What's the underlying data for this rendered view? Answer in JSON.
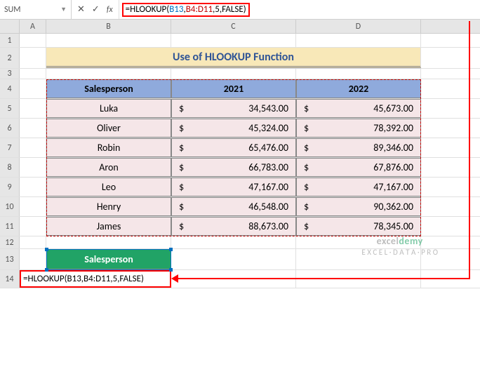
{
  "name_box": "SUM",
  "formula_bar": {
    "eq": "=",
    "fn": "HLOOKUP(",
    "ref1": "B13",
    "c1": ",",
    "ref2": "B4:D11",
    "c2": ",",
    "num": "5",
    "c3": ",",
    "bool": "FALSE",
    "close": ")"
  },
  "columns": {
    "A": "A",
    "B": "B",
    "C": "C",
    "D": "D"
  },
  "rows": [
    "1",
    "2",
    "3",
    "4",
    "5",
    "6",
    "7",
    "8",
    "9",
    "10",
    "11",
    "12",
    "13",
    "14"
  ],
  "title": "Use of HLOOKUP Function",
  "headers": {
    "salesperson": "Salesperson",
    "y2021": "2021",
    "y2022": "2022"
  },
  "data": [
    {
      "name": "Luka",
      "v21": "34,543.00",
      "v22": "45,673.00"
    },
    {
      "name": "Oliver",
      "v21": "45,324.00",
      "v22": "78,392.00"
    },
    {
      "name": "Robin",
      "v21": "65,476.00",
      "v22": "89,346.00"
    },
    {
      "name": "Aron",
      "v21": "66,783.00",
      "v22": "67,876.00"
    },
    {
      "name": "Leo",
      "v21": "47,167.00",
      "v22": "47,167.00"
    },
    {
      "name": "Henry",
      "v21": "46,548.00",
      "v22": "90,362.00"
    },
    {
      "name": "James",
      "v21": "88,673.00",
      "v22": "78,345.00"
    }
  ],
  "currency": "$",
  "lookup_header": "Salesperson",
  "cell_formula": "=HLOOKUP(B13,B4:D11,5,FALSE)",
  "watermark": {
    "brand1": "excel",
    "brand2": "demy",
    "tag": "E X C E L · D A T A · P R O"
  }
}
